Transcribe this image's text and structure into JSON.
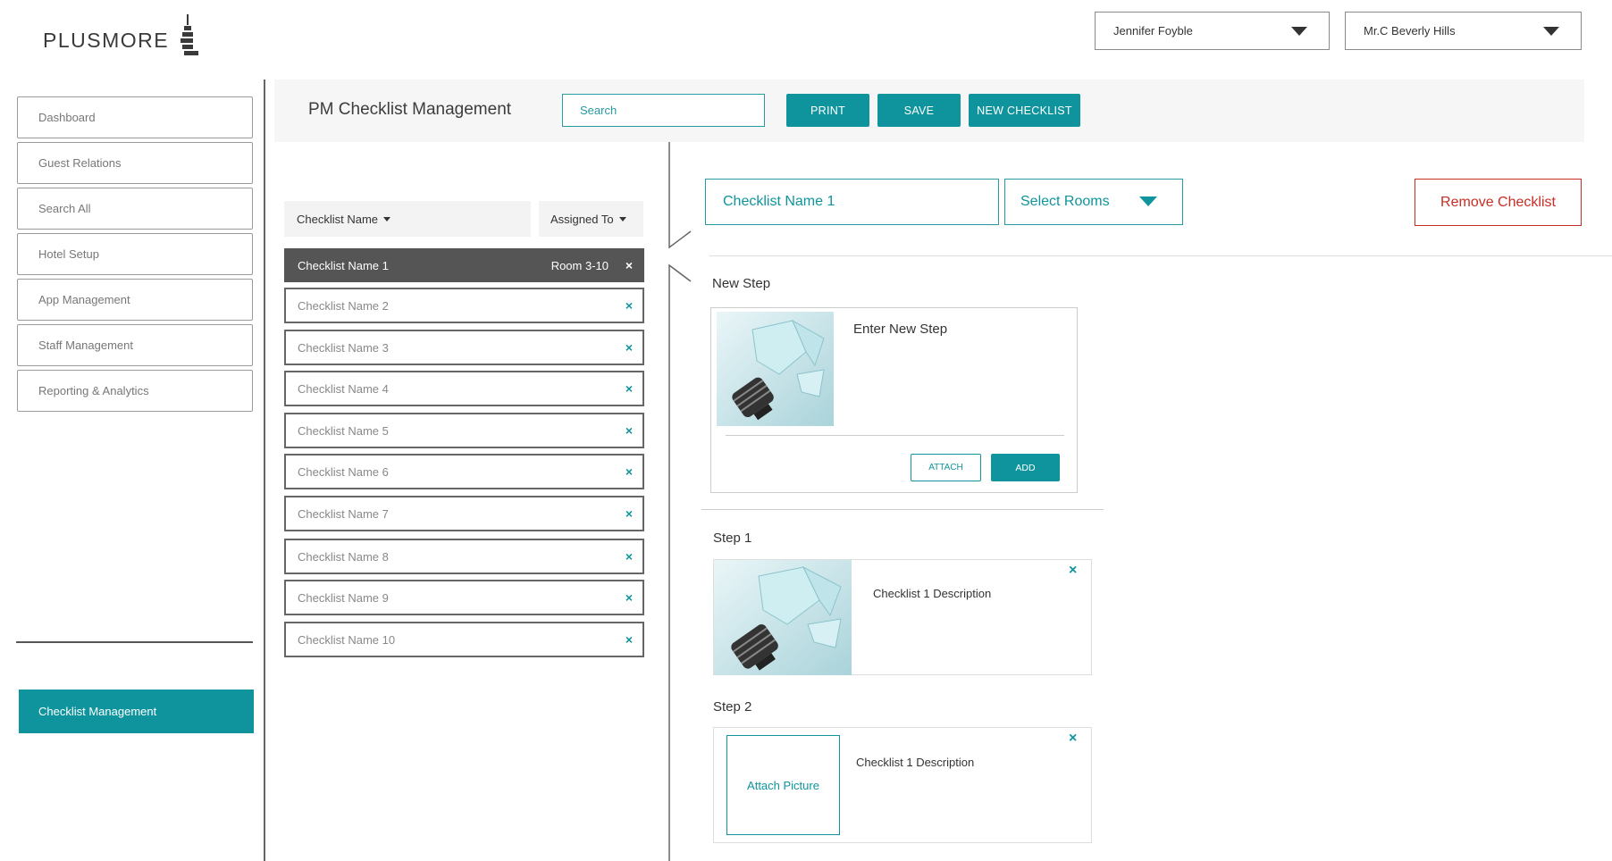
{
  "app": {
    "logo_text": "PLUSMORE"
  },
  "top": {
    "user_select": "Jennifer Foyble",
    "hotel_select": "Mr.C Beverly Hills"
  },
  "sidebar": {
    "items": [
      {
        "label": "Dashboard"
      },
      {
        "label": "Guest Relations"
      },
      {
        "label": "Search All"
      },
      {
        "label": "Hotel Setup"
      },
      {
        "label": "App Management"
      },
      {
        "label": "Staff Management"
      },
      {
        "label": "Reporting & Analytics"
      }
    ],
    "active_item": "Checklist Management"
  },
  "header": {
    "title": "PM Checklist Management",
    "search_placeholder": "Search",
    "print_label": "PRINT",
    "save_label": "SAVE",
    "new_checklist_label": "NEW CHECKLIST"
  },
  "list": {
    "col_name": "Checklist Name",
    "col_assigned": "Assigned To",
    "rows": [
      {
        "name": "Checklist Name 1",
        "room": "Room 3-10"
      },
      {
        "name": "Checklist Name 2"
      },
      {
        "name": "Checklist Name 3"
      },
      {
        "name": "Checklist Name 4"
      },
      {
        "name": "Checklist Name 5"
      },
      {
        "name": "Checklist Name 6"
      },
      {
        "name": "Checklist Name 7"
      },
      {
        "name": "Checklist Name 8"
      },
      {
        "name": "Checklist Name 9"
      },
      {
        "name": "Checklist Name 10"
      }
    ],
    "remove_icon": "×"
  },
  "detail": {
    "checklist_name": "Checklist Name 1",
    "select_rooms": "Select Rooms",
    "remove_label": "Remove Checklist",
    "new_step": {
      "label": "New Step",
      "placeholder": "Enter New Step",
      "attach_label": "ATTACH",
      "add_label": "ADD"
    },
    "steps": [
      {
        "label": "Step 1",
        "description": "Checklist 1 Description"
      },
      {
        "label": "Step 2",
        "description": "Checklist 1 Description",
        "attach_label": "Attach Picture"
      }
    ]
  },
  "colors": {
    "accent": "#0f949d",
    "danger": "#c62e24",
    "selected_row": "#555555"
  }
}
